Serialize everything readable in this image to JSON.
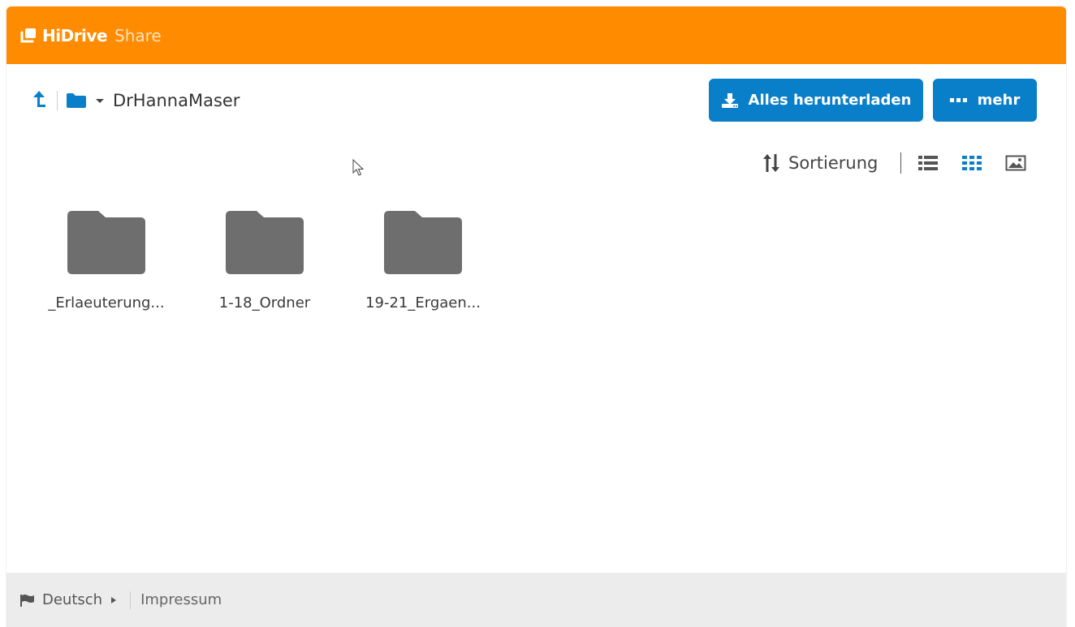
{
  "header": {
    "brand_name": "HiDrive",
    "brand_sub": "Share"
  },
  "breadcrumb": {
    "current_folder": "DrHannaMaser"
  },
  "actions": {
    "download_all_label": "Alles herunterladen",
    "more_label": "mehr"
  },
  "viewbar": {
    "sort_label": "Sortierung",
    "active_view": "grid"
  },
  "folders": [
    {
      "name": "_Erlaeuterung..."
    },
    {
      "name": "1-18_Ordner"
    },
    {
      "name": "19-21_Ergaen..."
    }
  ],
  "footer": {
    "language": "Deutsch",
    "impressum": "Impressum"
  },
  "colors": {
    "brand_orange": "#ff8c00",
    "primary_blue": "#0a7fc9",
    "folder_gray": "#6e6e6e",
    "footer_bg": "#ececec"
  },
  "icons": {
    "up": "arrow-up-icon",
    "folder": "folder-icon",
    "sort": "sort-icon",
    "list_view": "list-view-icon",
    "grid_view": "grid-view-icon",
    "gallery_view": "gallery-view-icon",
    "download": "download-icon",
    "more": "more-dots-icon",
    "flag": "flag-icon"
  }
}
